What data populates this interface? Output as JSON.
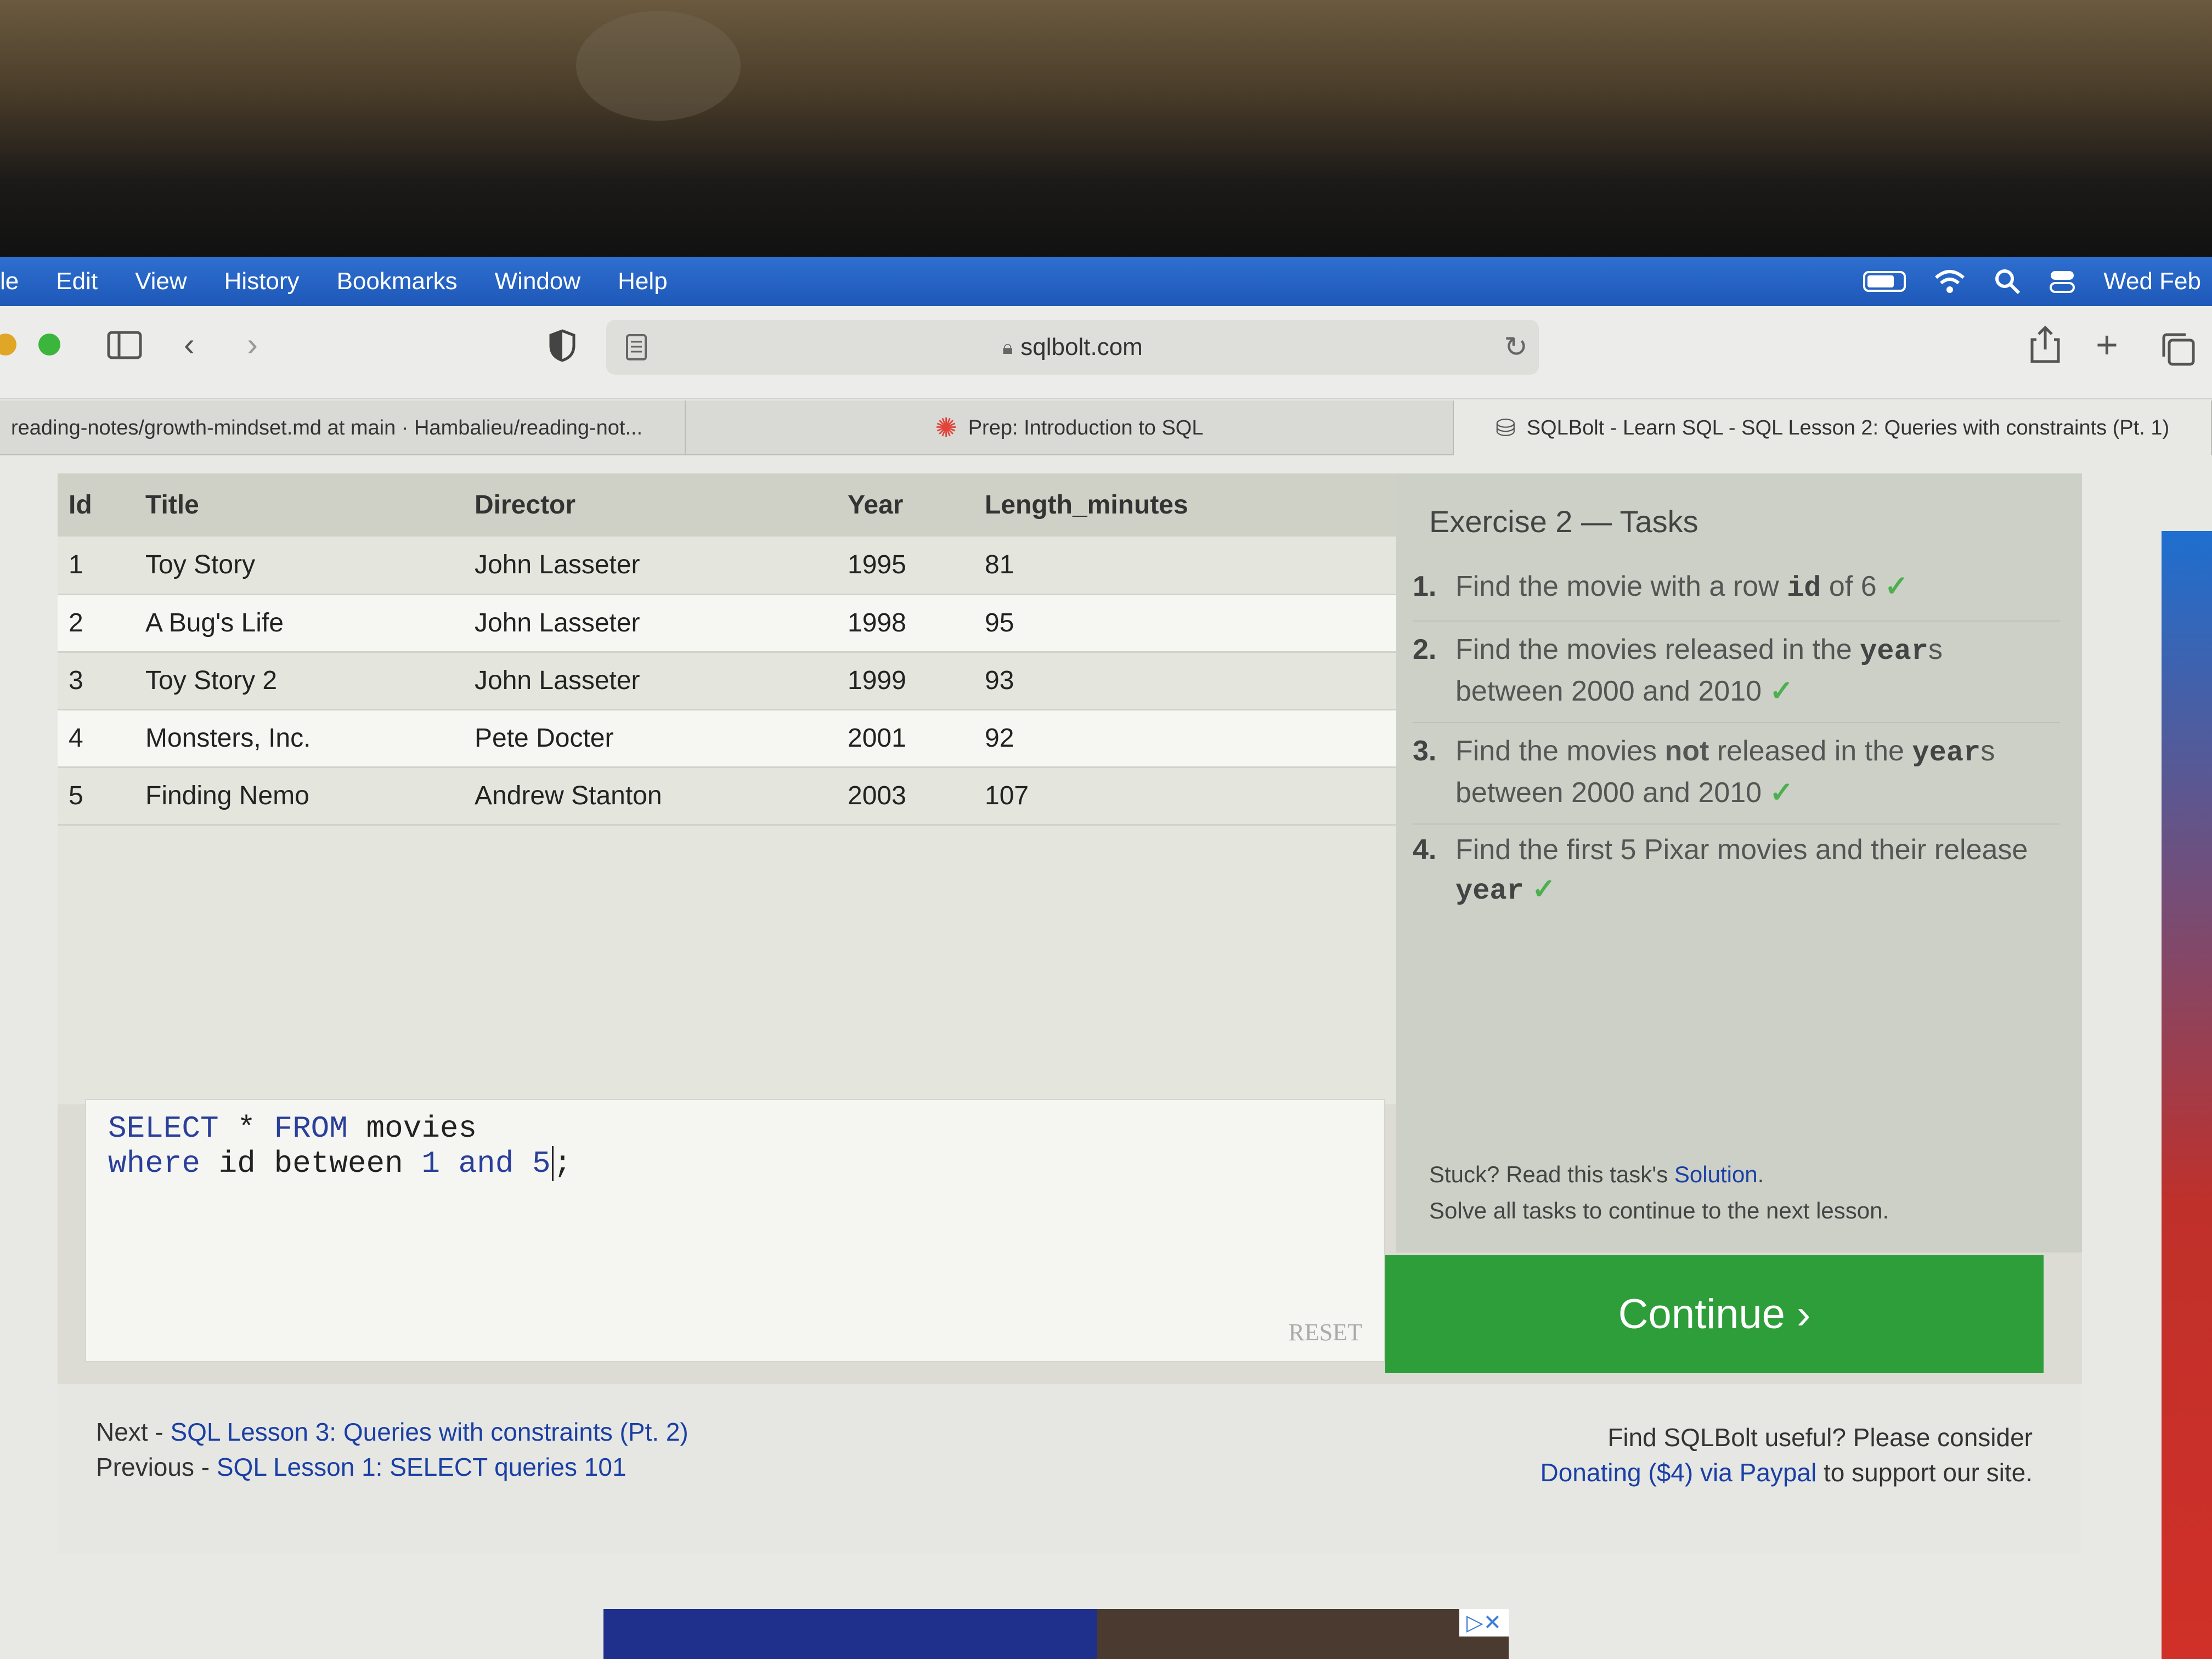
{
  "menubar": {
    "items": [
      "le",
      "Edit",
      "View",
      "History",
      "Bookmarks",
      "Window",
      "Help"
    ],
    "clock": "Wed Feb"
  },
  "toolbar": {
    "url": "sqlbolt.com"
  },
  "tabs": [
    {
      "label": "reading-notes/growth-mindset.md at main · Hambalieu/reading-not..."
    },
    {
      "label": "Prep: Introduction to SQL"
    },
    {
      "label": "SQLBolt - Learn SQL - SQL Lesson 2: Queries with constraints (Pt. 1)"
    }
  ],
  "results": {
    "columns": [
      "Id",
      "Title",
      "Director",
      "Year",
      "Length_minutes"
    ],
    "rows": [
      [
        "1",
        "Toy Story",
        "John Lasseter",
        "1995",
        "81"
      ],
      [
        "2",
        "A Bug's Life",
        "John Lasseter",
        "1998",
        "95"
      ],
      [
        "3",
        "Toy Story 2",
        "John Lasseter",
        "1999",
        "93"
      ],
      [
        "4",
        "Monsters, Inc.",
        "Pete Docter",
        "2001",
        "92"
      ],
      [
        "5",
        "Finding Nemo",
        "Andrew Stanton",
        "2003",
        "107"
      ]
    ]
  },
  "editor": {
    "line1_kw1": "SELECT",
    "line1_star": "*",
    "line1_kw2": "FROM",
    "line1_tbl": "movies",
    "line2_kw1": "where",
    "line2_col": "id",
    "line2_kw2": "between",
    "line2_n1": "1",
    "line2_kw3": "and",
    "line2_n2": "5",
    "line2_end": ";",
    "reset": "RESET"
  },
  "tasks": {
    "title": "Exercise 2 — Tasks",
    "items": [
      {
        "num": "1.",
        "pre": "Find the movie with a row ",
        "code": "id",
        "post": " of 6"
      },
      {
        "num": "2.",
        "pre": "Find the movies released in the ",
        "code": "year",
        "post": "s between 2000 and 2010"
      },
      {
        "num": "3.",
        "pre": "Find the movies ",
        "bold": "not",
        "mid": " released in the ",
        "code": "year",
        "post": "s between 2000 and 2010"
      },
      {
        "num": "4.",
        "pre": "Find the first 5 Pixar movies and their release ",
        "code": "year",
        "post": ""
      }
    ],
    "check": "✓",
    "stuck_pre": "Stuck? Read this task's ",
    "stuck_link": "Solution",
    "stuck_post": ".",
    "solve_all": "Solve all tasks to continue to the next lesson.",
    "continue": "Continue ›"
  },
  "footer": {
    "next_label": "Next - ",
    "next_link": "SQL Lesson 3: Queries with constraints (Pt. 2)",
    "prev_label": "Previous - ",
    "prev_link": "SQL Lesson 1: SELECT queries 101",
    "donate_pre": "Find SQLBolt useful? Please consider",
    "donate_link": "Donating ($4) via Paypal",
    "donate_post": " to support our site."
  },
  "colors": {
    "continue_bg": "#2e9e3a",
    "link": "#1a3fa5",
    "menubar": "#2e6fd0"
  }
}
